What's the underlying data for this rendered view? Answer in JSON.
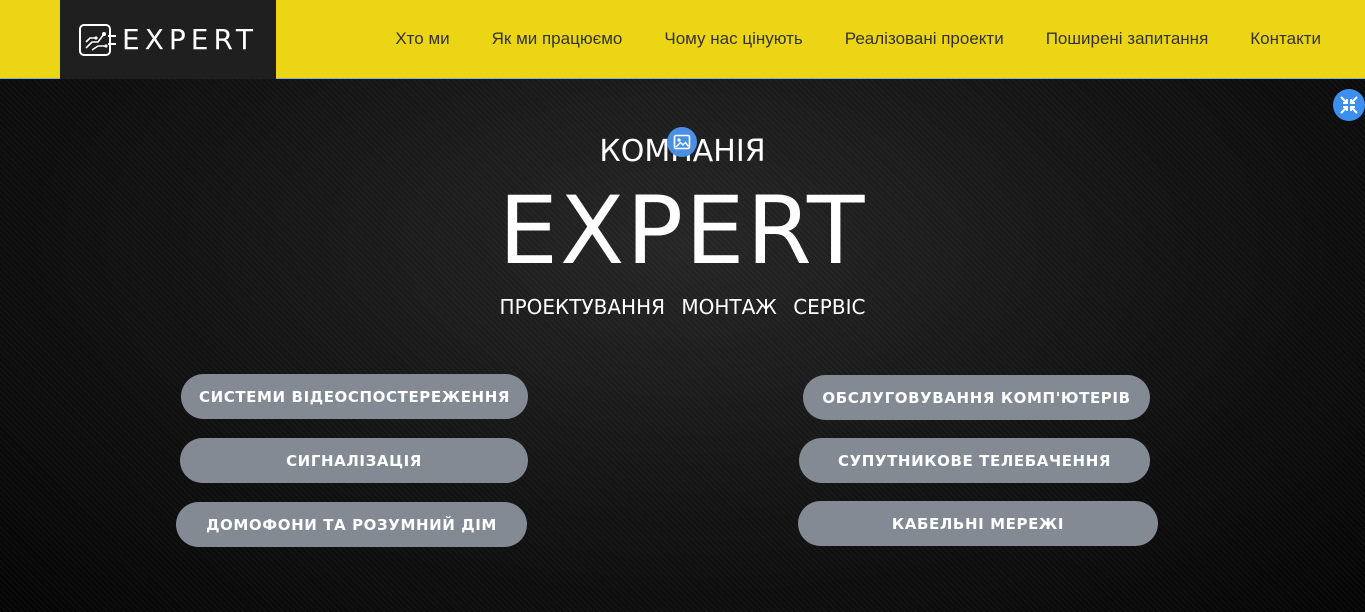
{
  "header": {
    "logo_text": "EXPERT",
    "nav": [
      "Хто ми",
      "Як ми працюємо",
      "Чому нас цінують",
      "Реалізовані проекти",
      "Поширені запитання",
      "Контакти"
    ]
  },
  "hero": {
    "subtitle": "КОМПАНІЯ",
    "title": "EXPERT",
    "tagline": "ПРОЕКТУВАННЯ МОНТАЖ СЕРВІС"
  },
  "services": [
    "СИСТЕМИ ВІДЕОСПОСТЕРЕЖЕННЯ",
    "СИГНАЛІЗАЦІЯ",
    "ДОМОФОНИ ТА РОЗУМНИЙ ДІМ",
    "ОБСЛУГОВУВАННЯ КОМП'ЮТЕРІВ",
    "СУПУТНИКОВЕ ТЕЛЕБАЧЕННЯ",
    "КАБЕЛЬНІ МЕРЕЖІ"
  ],
  "icons": {
    "fullscreen": "collapse-arrows-icon",
    "image": "image-icon",
    "logo": "circuit-logo-icon"
  },
  "colors": {
    "header_bg": "#ecd515",
    "logo_bg": "#1f1f1f",
    "button_bg": "#838a94",
    "accent_blue": "#3d8fef"
  }
}
